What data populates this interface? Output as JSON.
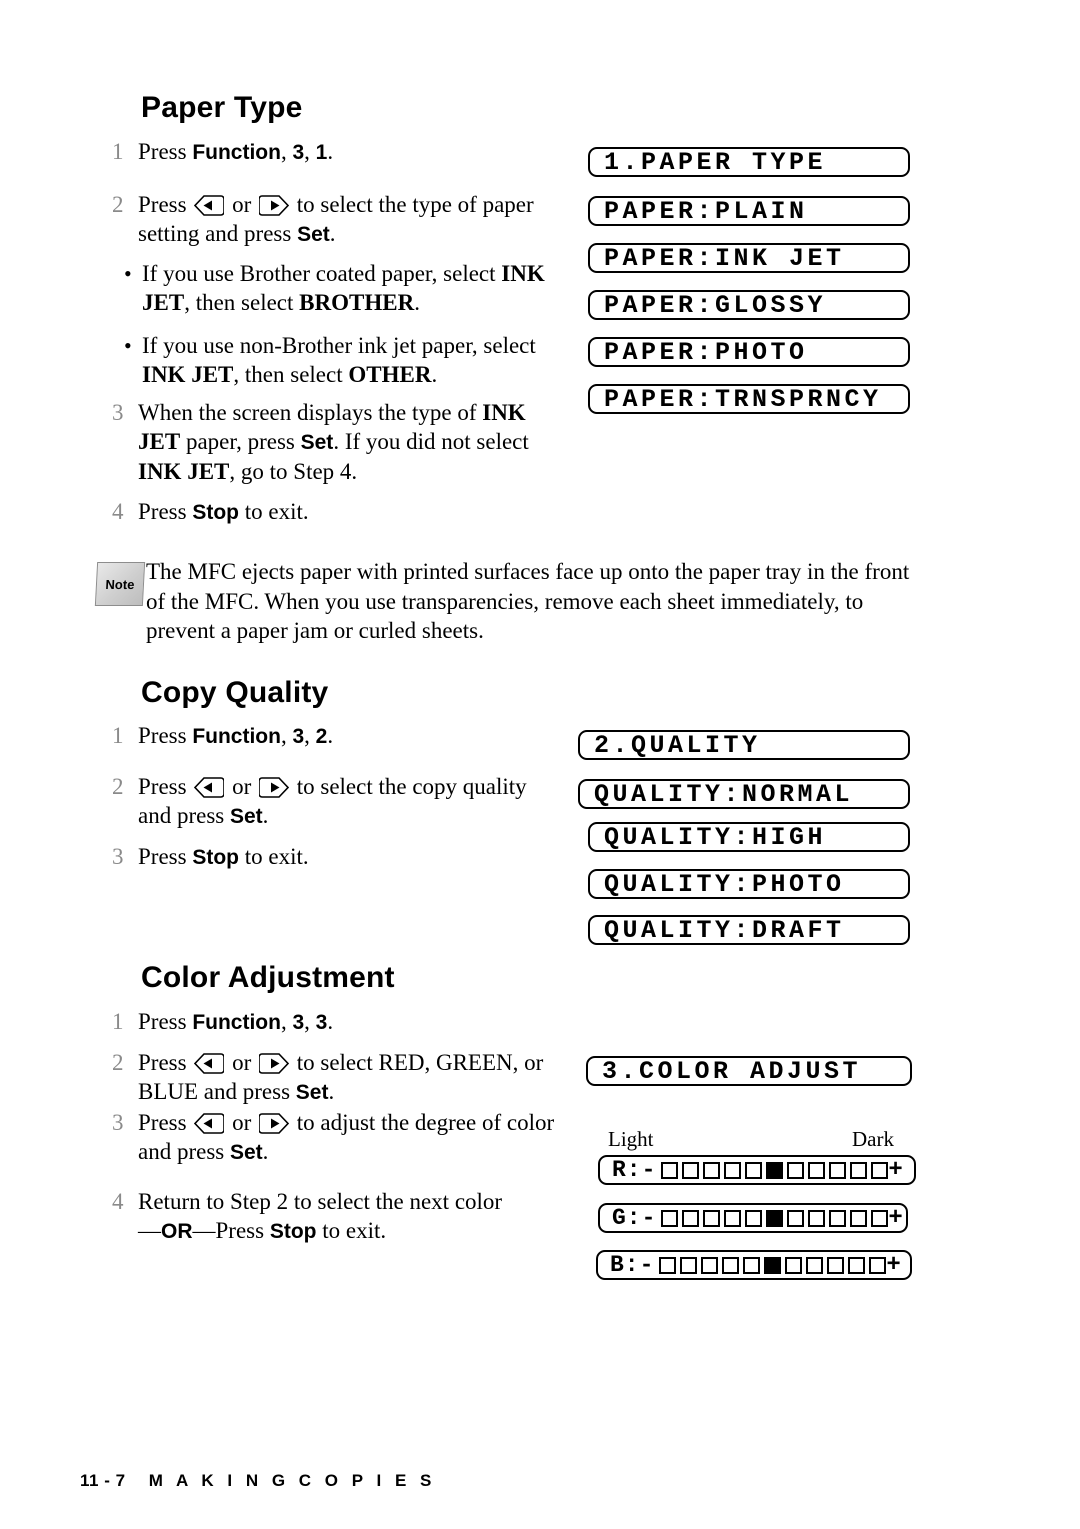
{
  "document": {
    "sections": [
      {
        "id": "paper-type",
        "title": "Paper Type",
        "steps": [
          {
            "num": "1",
            "html": "Press <span class=\"sans-b\">Function</span>, <span class=\"sans-b\">3</span>, <span class=\"sans-b\">1</span>."
          },
          {
            "num": "2",
            "html": "Press KEY1 or KEY2 to select the type of paper setting and press <span class=\"sans-b\">Set</span>."
          },
          {
            "num": "3",
            "html": "When the screen displays the type of <span class=\"b\">INK JET</span> paper, press <span class=\"sans-b\">Set</span>.  If you did not select <span class=\"b\">INK JET</span>, go to Step 4."
          },
          {
            "num": "4",
            "html": "Press <span class=\"sans-b\">Stop</span> to exit."
          }
        ],
        "bullets": [
          {
            "html": "If you use Brother coated paper, select <span class=\"b\">INK JET</span>, then select <span class=\"b\">BROTHER</span>."
          },
          {
            "html": "If you use non-Brother ink jet paper, select <span class=\"b\">INK JET</span>, then select <span class=\"b\">OTHER</span>."
          }
        ],
        "lcd": [
          "1.PAPER TYPE",
          "PAPER:PLAIN",
          "PAPER:INK JET",
          "PAPER:GLOSSY",
          "PAPER:PHOTO",
          "PAPER:TRNSPRNCY"
        ]
      },
      {
        "id": "copy-quality",
        "title": "Copy Quality",
        "steps": [
          {
            "num": "1",
            "html": "Press <span class=\"sans-b\">Function</span>, <span class=\"sans-b\">3</span>, <span class=\"sans-b\">2</span>."
          },
          {
            "num": "2",
            "html": "Press KEY1 or KEY2 to select the copy quality and press <span class=\"sans-b\">Set</span>."
          },
          {
            "num": "3",
            "html": "Press <span class=\"sans-b\">Stop</span> to exit."
          }
        ],
        "lcd": [
          "2.QUALITY",
          "QUALITY:NORMAL",
          "QUALITY:HIGH",
          "QUALITY:PHOTO",
          "QUALITY:DRAFT"
        ]
      },
      {
        "id": "color-adjustment",
        "title": "Color Adjustment",
        "steps": [
          {
            "num": "1",
            "html": "Press <span class=\"sans-b\">Function</span>, <span class=\"sans-b\">3</span>, <span class=\"sans-b\">3</span>."
          },
          {
            "num": "2",
            "html": "Press KEY1 or KEY2 to select RED, GREEN, or BLUE and press <span class=\"sans-b\">Set</span>."
          },
          {
            "num": "3",
            "html": "Press KEY1 or KEY2 to adjust the degree of color and press <span class=\"sans-b\">Set</span>."
          },
          {
            "num": "4",
            "html": "Return to Step 2 to select the next color <br>&#8212;<span class=\"sans-b\">OR</span>&#8212;Press <span class=\"sans-b\">Stop</span> to exit."
          }
        ],
        "lcd": [
          "3.COLOR ADJUST"
        ],
        "scale_labels": {
          "light": "Light",
          "dark": "Dark"
        },
        "color_bars": [
          {
            "label": "R:",
            "minus": "-",
            "plus": "+",
            "cells": 11,
            "filled_index": 5
          },
          {
            "label": "G:",
            "minus": "-",
            "plus": "+",
            "cells": 11,
            "filled_index": 5
          },
          {
            "label": "B:",
            "minus": "-",
            "plus": "+",
            "cells": 11,
            "filled_index": 5
          }
        ]
      }
    ],
    "note": {
      "badge": "Note",
      "text": "The MFC ejects paper with printed surfaces face up onto the paper tray in the front of the MFC. When you use transparencies, remove each sheet immediately, to prevent a paper jam or curled sheets."
    },
    "footer": {
      "page": "11 - 7",
      "chapter": "M A K I N G   C O P I E S"
    }
  }
}
